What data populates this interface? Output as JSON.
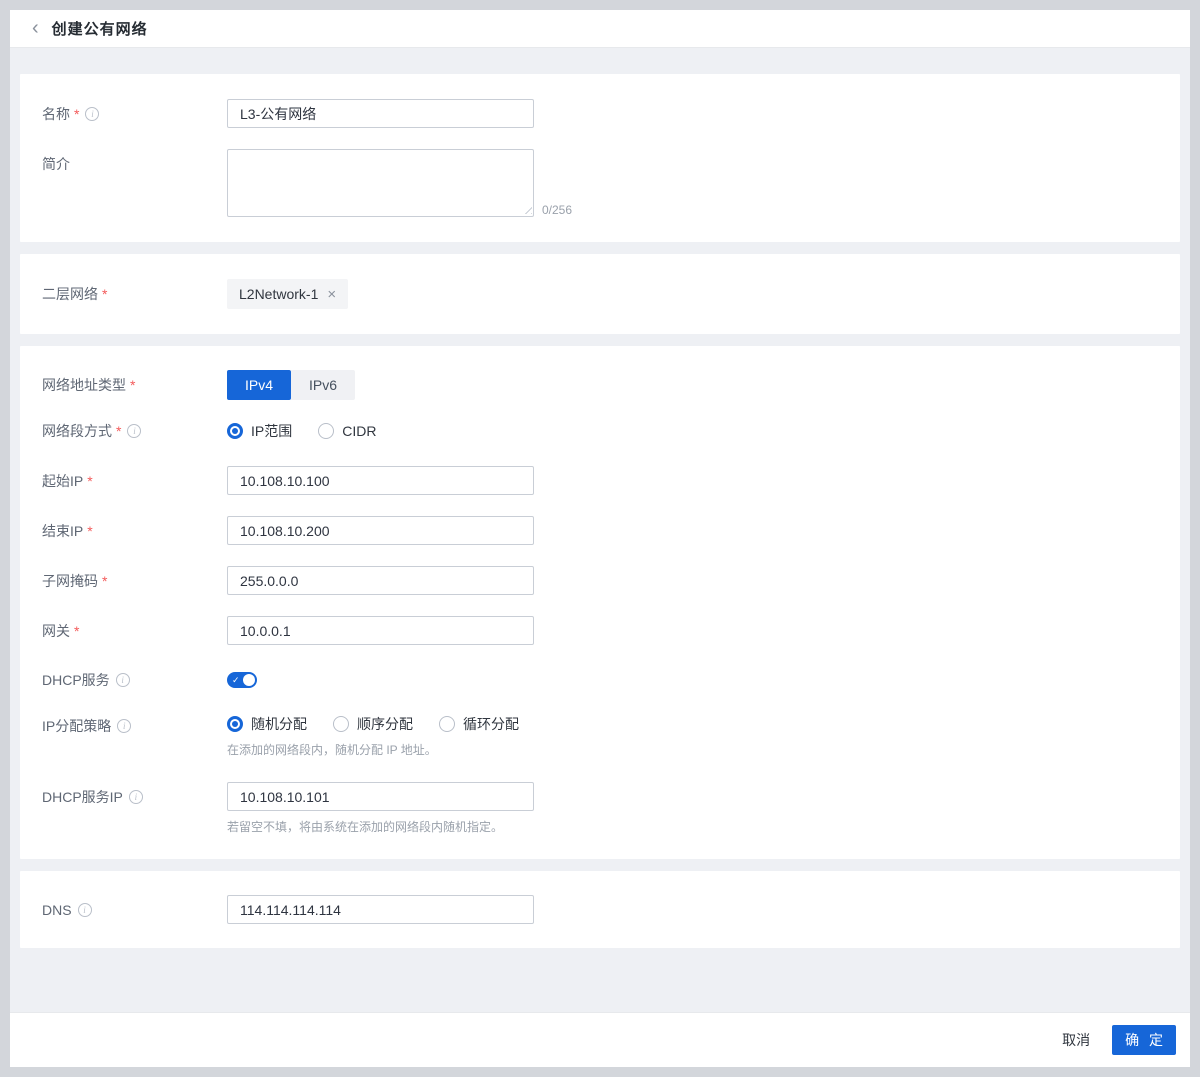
{
  "header": {
    "title": "创建公有网络"
  },
  "icons": {
    "back": "‹",
    "info": "i",
    "close": "×",
    "check": "✓"
  },
  "ui": {
    "required_marker": "*"
  },
  "form": {
    "name": {
      "label": "名称",
      "value": "L3-公有网络"
    },
    "description": {
      "label": "简介",
      "value": "",
      "counter": "0/256"
    },
    "l2_network": {
      "label": "二层网络",
      "tag": "L2Network-1"
    },
    "address_type": {
      "label": "网络地址类型",
      "options": [
        "IPv4",
        "IPv6"
      ],
      "selected": "IPv4"
    },
    "segment_mode": {
      "label": "网络段方式",
      "options": [
        "IP范围",
        "CIDR"
      ],
      "selected": "IP范围"
    },
    "start_ip": {
      "label": "起始IP",
      "value": "10.108.10.100"
    },
    "end_ip": {
      "label": "结束IP",
      "value": "10.108.10.200"
    },
    "netmask": {
      "label": "子网掩码",
      "value": "255.0.0.0"
    },
    "gateway": {
      "label": "网关",
      "value": "10.0.0.1"
    },
    "dhcp_service": {
      "label": "DHCP服务",
      "enabled": true
    },
    "ip_alloc": {
      "label": "IP分配策略",
      "options": [
        "随机分配",
        "顺序分配",
        "循环分配"
      ],
      "selected": "随机分配",
      "help": "在添加的网络段内，随机分配 IP 地址。"
    },
    "dhcp_ip": {
      "label": "DHCP服务IP",
      "value": "10.108.10.101",
      "help": "若留空不填，将由系统在添加的网络段内随机指定。"
    },
    "dns": {
      "label": "DNS",
      "value": "114.114.114.114"
    }
  },
  "footer": {
    "cancel": "取消",
    "confirm": "确 定"
  },
  "colors": {
    "primary": "#1666d8",
    "required": "#f35a5a",
    "page_bg": "#eef0f4"
  }
}
